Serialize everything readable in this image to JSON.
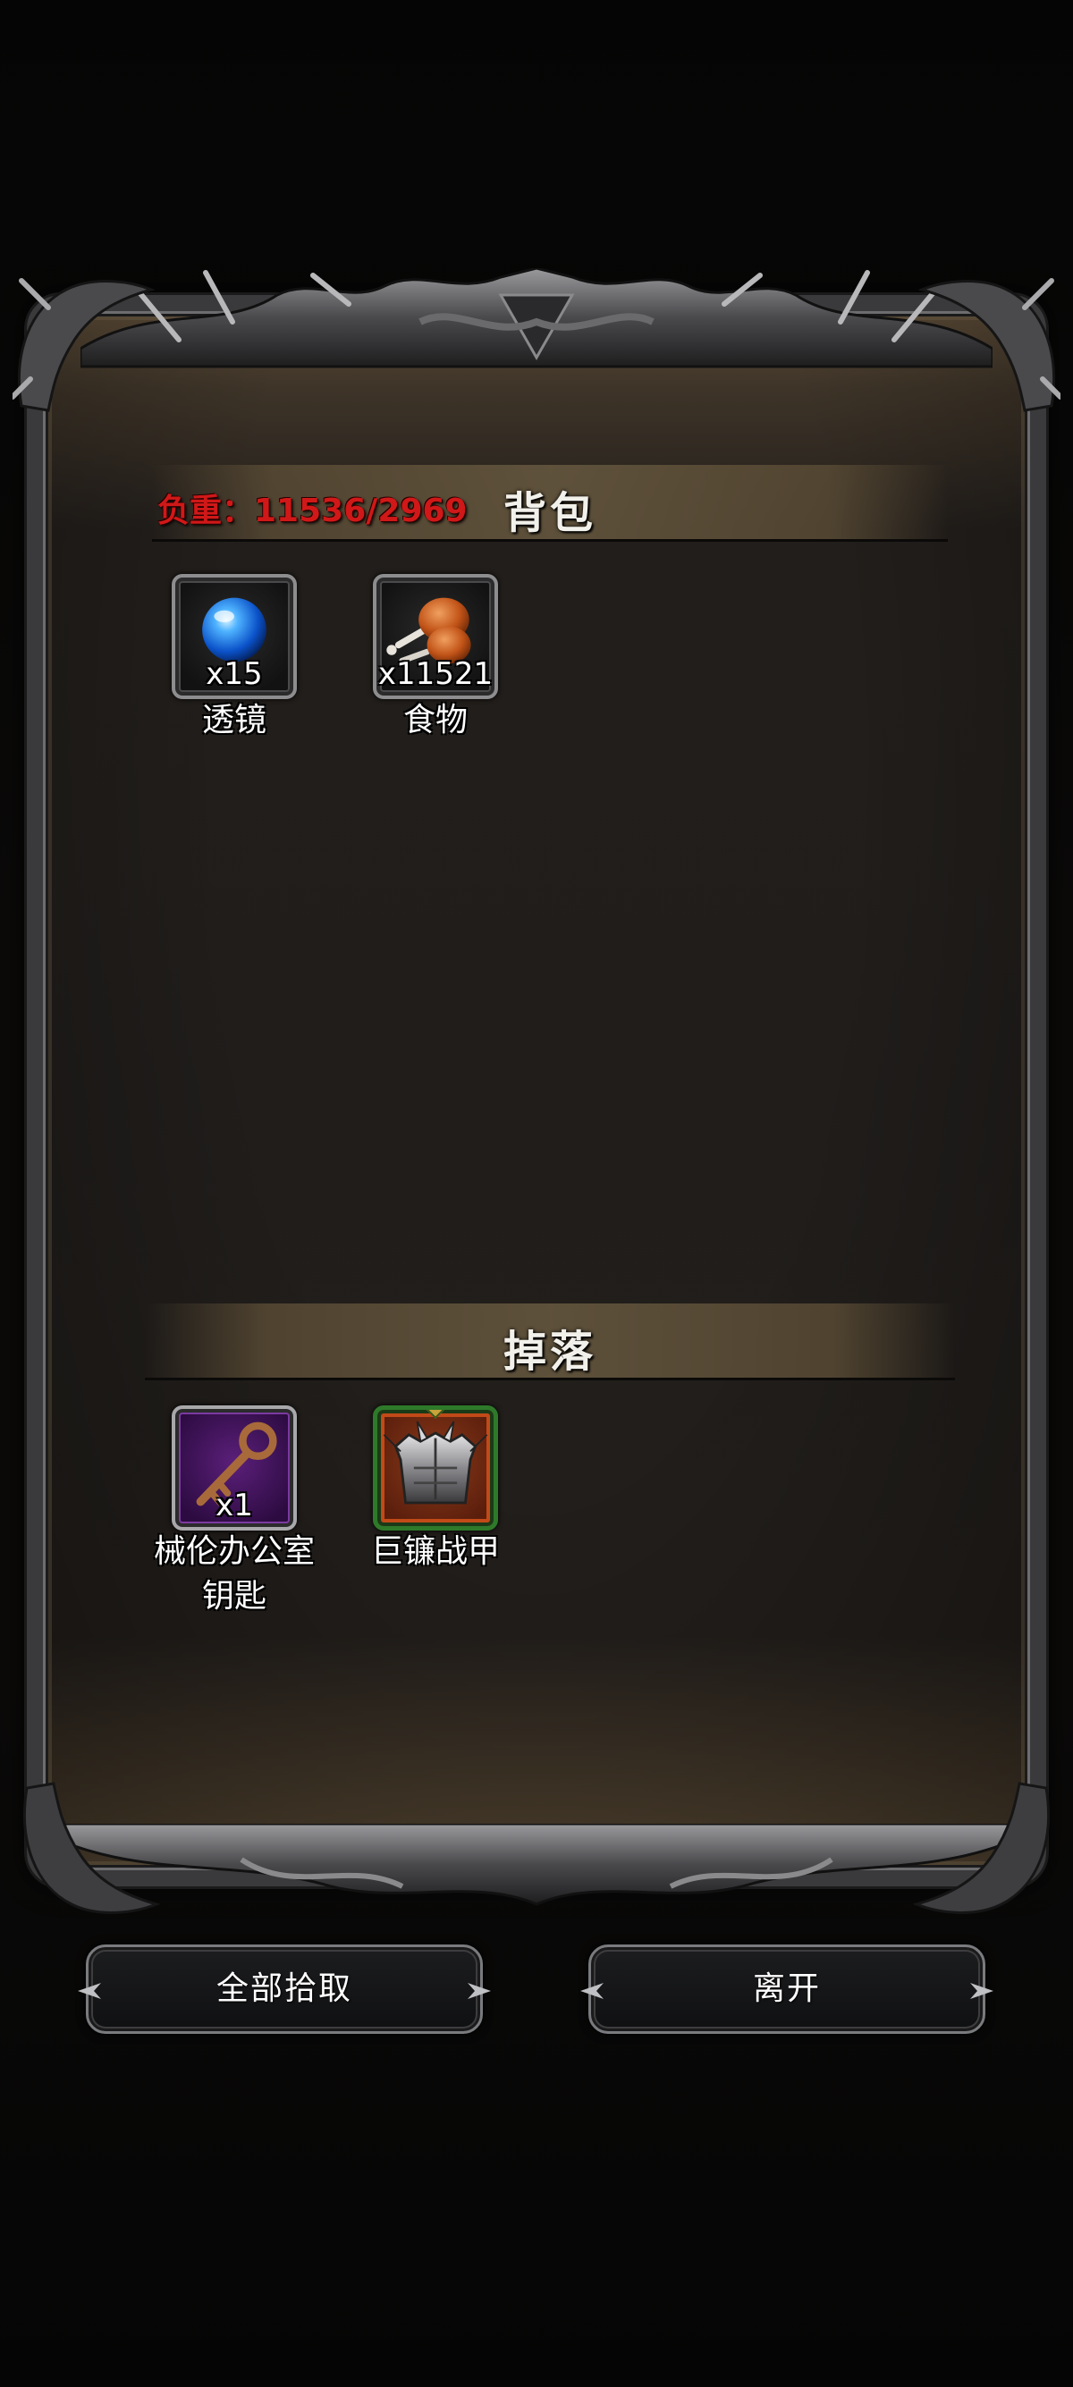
{
  "inventory": {
    "weight_text": "负重：11536/2969",
    "title": "背包",
    "items": [
      {
        "name": "透镜",
        "qty": "x15",
        "icon": "blue-orb-lens-icon"
      },
      {
        "name": "食物",
        "qty": "x11521",
        "icon": "roast-meat-icon"
      }
    ]
  },
  "drops": {
    "title": "掉落",
    "items": [
      {
        "name_line1": "械伦办公室",
        "name_line2": "钥匙",
        "qty": "x1",
        "icon": "bronze-key-icon"
      },
      {
        "name": "巨镰战甲",
        "qty": "",
        "icon": "spiked-armor-icon"
      }
    ]
  },
  "buttons": {
    "pick_all": "全部拾取",
    "leave": "离开"
  },
  "colors": {
    "weight_red": "#d01818",
    "panel_bg": "#201d1b",
    "header_band": "#645640",
    "frame_metal": "#3a3a3c",
    "rare_purple": "#5b1f7a",
    "armor_orange": "#c24a18",
    "armor_green": "#2e7a2a"
  }
}
